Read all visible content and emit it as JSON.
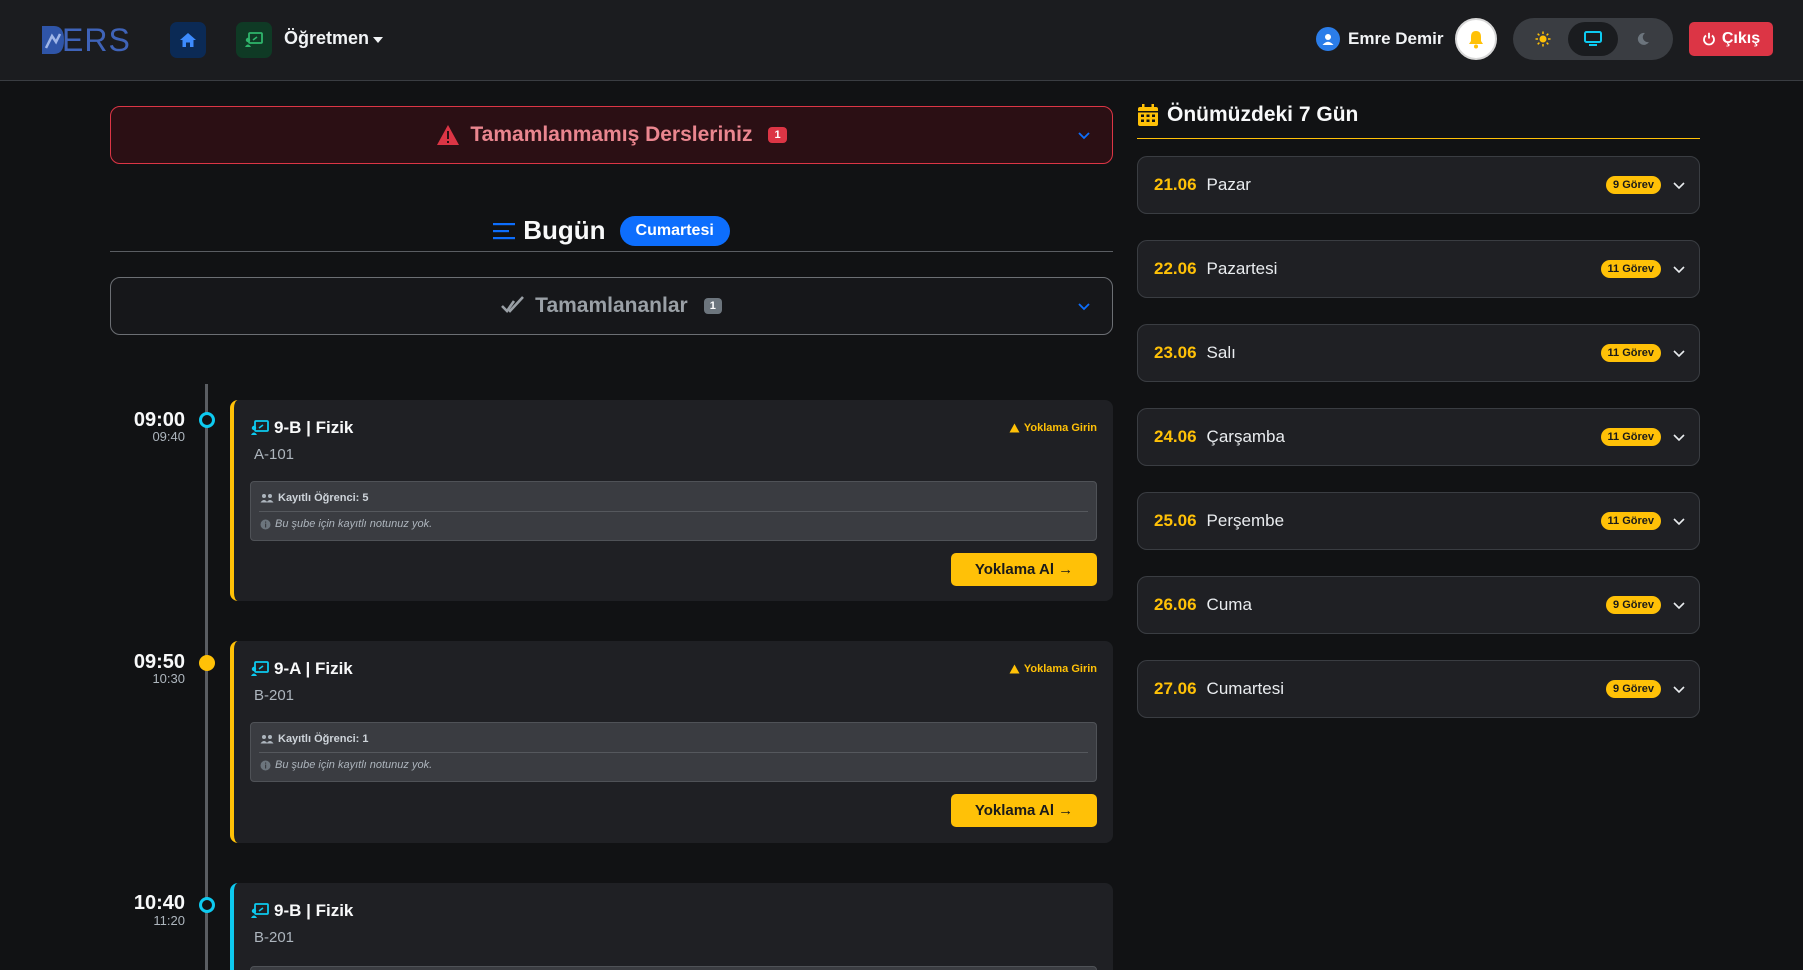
{
  "navbar": {
    "logo_text": "ERS",
    "role_label": "Öğretmen",
    "user_name": "Emre Demir",
    "logout_label": "Çıkış"
  },
  "incomplete": {
    "title": "Tamamlanmamış Dersleriniz",
    "count": "1"
  },
  "today": {
    "title": "Bugün",
    "day": "Cumartesi"
  },
  "completed": {
    "title": "Tamamlananlar",
    "count": "1"
  },
  "lessons": [
    {
      "start": "09:00",
      "end": "09:40",
      "title": "9-B | Fizik",
      "room": "A-101",
      "warning": "Yoklama Girin",
      "registered": "Kayıtlı Öğrenci: 5",
      "note": "Bu şube için kayıtlı notunuz yok.",
      "button": "Yoklama Al →"
    },
    {
      "start": "09:50",
      "end": "10:30",
      "title": "9-A | Fizik",
      "room": "B-201",
      "warning": "Yoklama Girin",
      "registered": "Kayıtlı Öğrenci: 1",
      "note": "Bu şube için kayıtlı notunuz yok.",
      "button": "Yoklama Al →"
    },
    {
      "start": "10:40",
      "end": "11:20",
      "title": "9-B | Fizik",
      "room": "B-201"
    }
  ],
  "upcoming": {
    "title": "Önümüzdeki 7 Gün",
    "days": [
      {
        "date": "21.06",
        "name": "Pazar",
        "tasks": "9 Görev"
      },
      {
        "date": "22.06",
        "name": "Pazartesi",
        "tasks": "11 Görev"
      },
      {
        "date": "23.06",
        "name": "Salı",
        "tasks": "11 Görev"
      },
      {
        "date": "24.06",
        "name": "Çarşamba",
        "tasks": "11 Görev"
      },
      {
        "date": "25.06",
        "name": "Perşembe",
        "tasks": "11 Görev"
      },
      {
        "date": "26.06",
        "name": "Cuma",
        "tasks": "9 Görev"
      },
      {
        "date": "27.06",
        "name": "Cumartesi",
        "tasks": "9 Görev"
      }
    ]
  },
  "colors": {
    "accent": "#ffc107",
    "danger": "#dc3545",
    "primary": "#0d6efd",
    "info": "#0dcaf0"
  }
}
